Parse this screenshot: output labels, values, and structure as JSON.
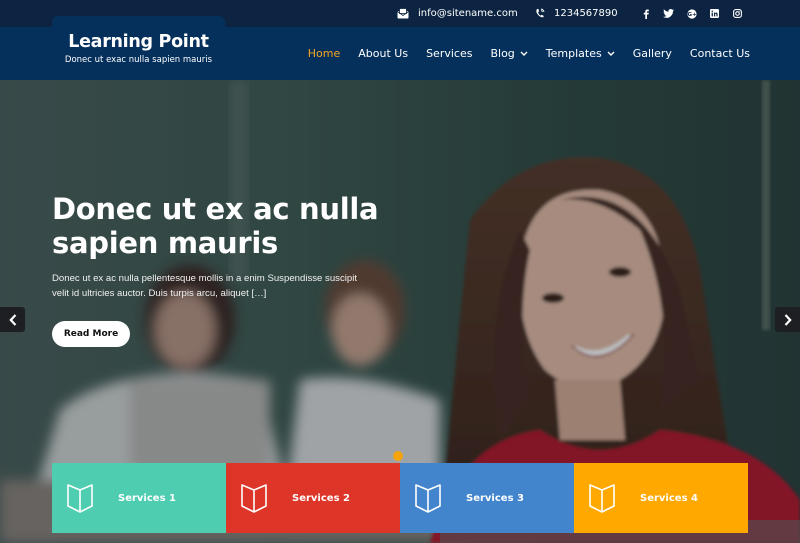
{
  "topbar": {
    "email": "info@sitename.com",
    "phone": "1234567890",
    "social": [
      {
        "name": "facebook-icon",
        "glyph": "f"
      },
      {
        "name": "twitter-icon",
        "glyph": "t"
      },
      {
        "name": "google-plus-icon",
        "glyph": "g"
      },
      {
        "name": "linkedin-icon",
        "glyph": "in"
      },
      {
        "name": "instagram-icon",
        "glyph": "ig"
      }
    ]
  },
  "brand": {
    "title": "Learning Point",
    "tagline": "Donec ut exac nulla sapien mauris"
  },
  "nav": {
    "items": [
      {
        "label": "Home",
        "active": true,
        "dropdown": false
      },
      {
        "label": "About Us",
        "active": false,
        "dropdown": false
      },
      {
        "label": "Services",
        "active": false,
        "dropdown": false
      },
      {
        "label": "Blog",
        "active": false,
        "dropdown": true
      },
      {
        "label": "Templates",
        "active": false,
        "dropdown": true
      },
      {
        "label": "Gallery",
        "active": false,
        "dropdown": false
      },
      {
        "label": "Contact Us",
        "active": false,
        "dropdown": false
      }
    ]
  },
  "hero": {
    "title": "Donec ut ex ac nulla sapien mauris",
    "text": "Donec ut ex ac nulla pellentesque mollis in a enim Suspendisse suscipit velit id ultricies auctor. Duis turpis arcu, aliquet […]",
    "button": "Read More",
    "slides_total": 1,
    "slide_active": 1
  },
  "services": [
    {
      "label": "Services 1",
      "color": "#4ecdb0"
    },
    {
      "label": "Services 2",
      "color": "#dd3527"
    },
    {
      "label": "Services 3",
      "color": "#4285cc"
    },
    {
      "label": "Services 4",
      "color": "#ffa800"
    }
  ],
  "colors": {
    "topbar": "#0c2441",
    "navbar": "#05305c",
    "accent": "#f5a623"
  }
}
